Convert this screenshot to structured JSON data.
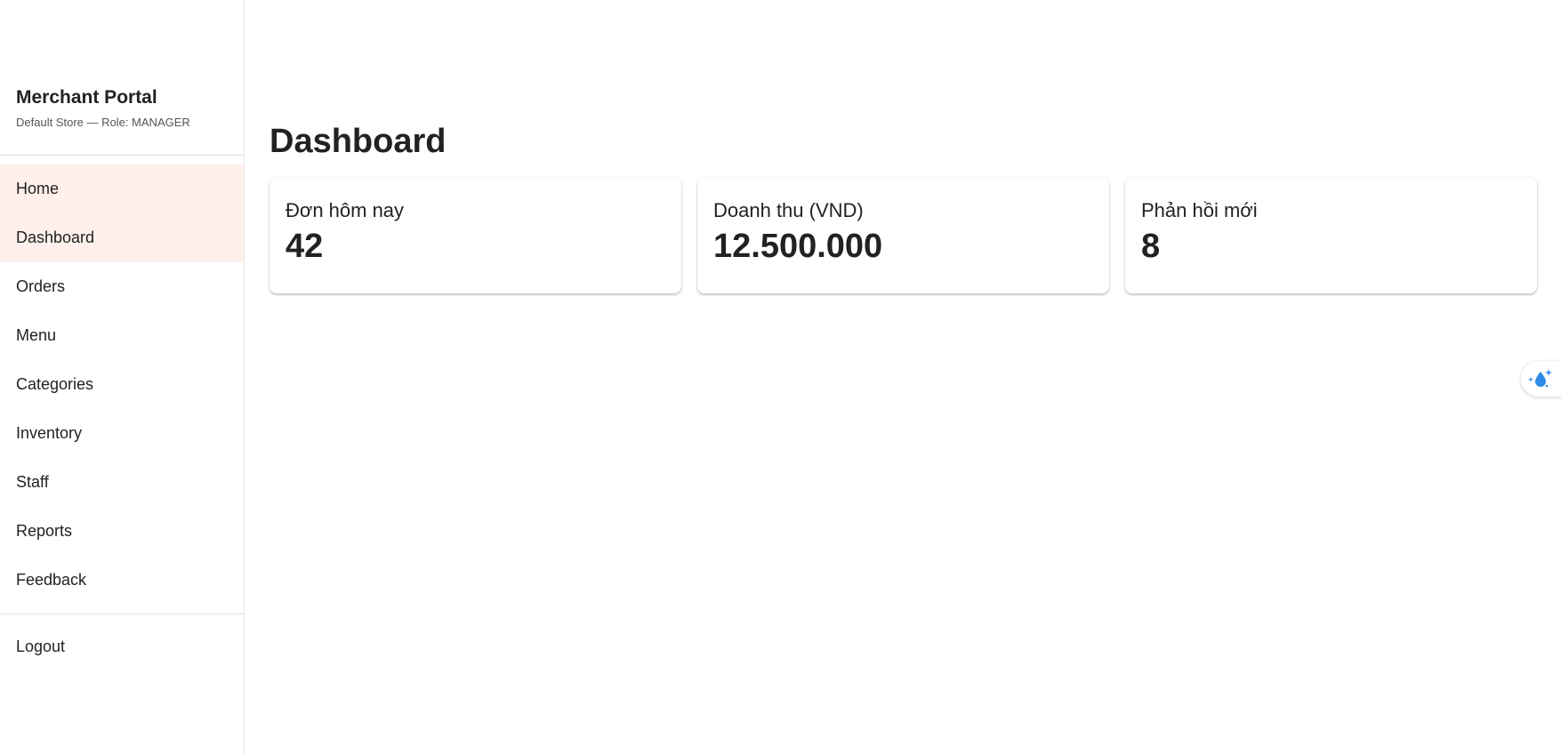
{
  "sidebar": {
    "title": "Merchant Portal",
    "subtitle": "Default Store — Role: MANAGER",
    "items": [
      {
        "label": "Home"
      },
      {
        "label": "Dashboard"
      },
      {
        "label": "Orders"
      },
      {
        "label": "Menu"
      },
      {
        "label": "Categories"
      },
      {
        "label": "Inventory"
      },
      {
        "label": "Staff"
      },
      {
        "label": "Reports"
      },
      {
        "label": "Feedback"
      }
    ],
    "logout_label": "Logout"
  },
  "main": {
    "title": "Dashboard",
    "cards": [
      {
        "label": "Đơn hôm nay",
        "value": "42"
      },
      {
        "label": "Doanh thu (VND)",
        "value": "12.500.000"
      },
      {
        "label": "Phản hồi mới",
        "value": "8"
      }
    ]
  },
  "floating_widget": {
    "icon": "water-drop-sparkle-icon",
    "color": "#2f8be6"
  },
  "colors": {
    "active_nav_bg": "#fff0ec",
    "text": "#222222"
  }
}
